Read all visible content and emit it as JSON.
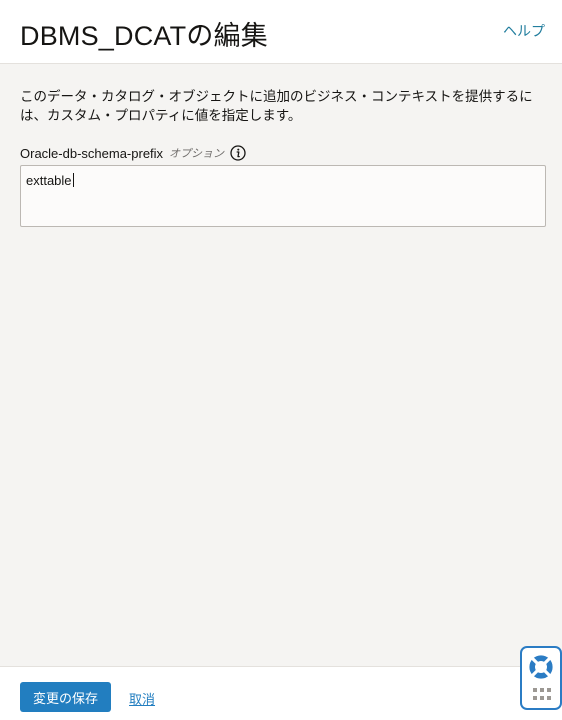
{
  "header": {
    "title": "DBMS_DCATの編集",
    "help_link": "ヘルプ"
  },
  "content": {
    "description": "このデータ・カタログ・オブジェクトに追加のビジネス・コンテキストを提供するには、カスタム・プロパティに値を指定します。",
    "field": {
      "label": "Oracle-db-schema-prefix",
      "optional": "オプション",
      "value": "exttable"
    }
  },
  "footer": {
    "save_label": "変更の保存",
    "cancel_label": "取消"
  },
  "colors": {
    "accent": "#227ec0",
    "link": "#227e9e",
    "background": "#f5f4f2"
  }
}
